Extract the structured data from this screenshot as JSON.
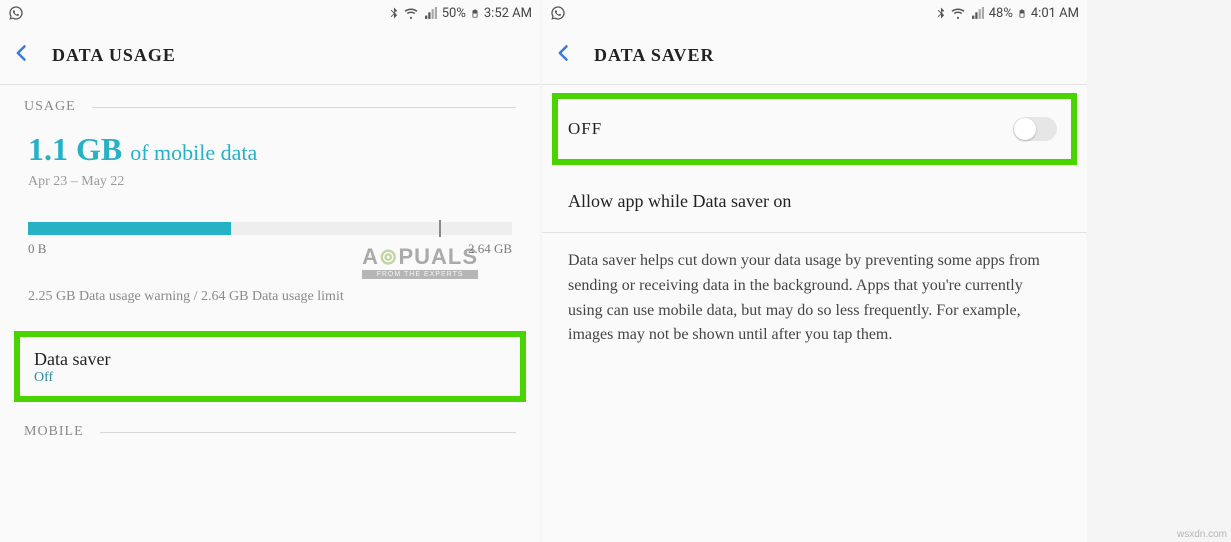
{
  "left": {
    "statusbar": {
      "battery_pct": "50%",
      "time": "3:52 AM"
    },
    "appbar_title": "DATA USAGE",
    "usage_header": "USAGE",
    "usage_amount": "1.1 GB",
    "usage_of_label": "of mobile data",
    "usage_period": "Apr 23 – May 22",
    "progress_min": "0 B",
    "progress_max": "2.64 GB",
    "usage_note": "2.25 GB Data usage warning / 2.64 GB Data usage limit",
    "data_saver_row": {
      "title": "Data saver",
      "sub": "Off"
    },
    "mobile_header": "MOBILE"
  },
  "right": {
    "statusbar": {
      "battery_pct": "48%",
      "time": "4:01 AM"
    },
    "appbar_title": "DATA SAVER",
    "toggle_label": "OFF",
    "allow_row": "Allow app while Data saver on",
    "body": "Data saver helps cut down your data usage by preventing some apps from sending or receiving data in the background. Apps that you're currently using can use mobile data, but may do so less frequently. For example, images may not be shown until after you tap them."
  },
  "watermark": {
    "brand": "A  PUALS",
    "tag": "FROM THE EXPERTS"
  },
  "footer": "wsxdn.com"
}
